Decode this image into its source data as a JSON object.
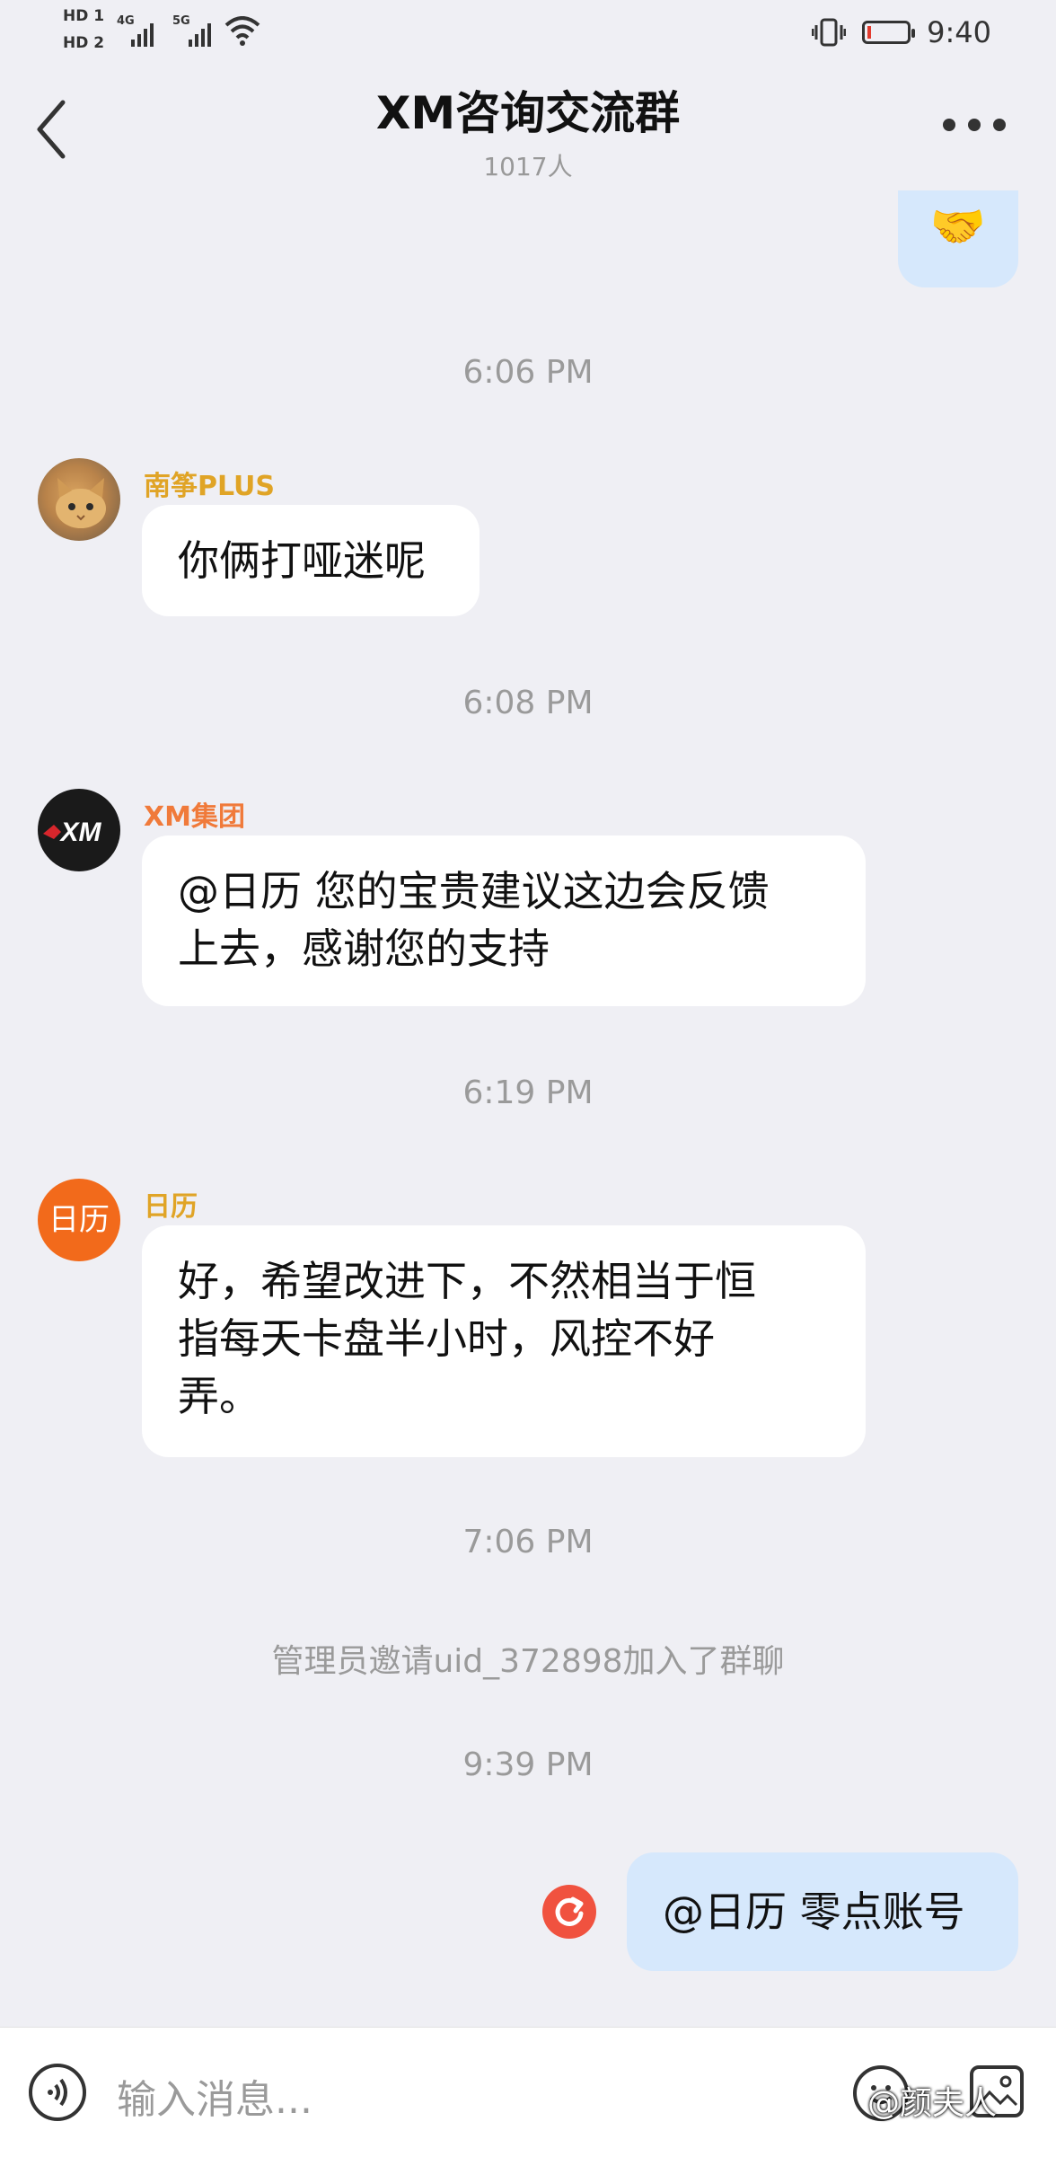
{
  "status_bar": {
    "hd1": "HD 1",
    "hd2": "HD 2",
    "net1": "4G",
    "net2": "5G",
    "time": "9:40"
  },
  "header": {
    "title": "XM咨询交流群",
    "member_count": "1017人"
  },
  "messages": [
    {
      "type": "outgoing-emoji",
      "emoji": "🤝"
    },
    {
      "type": "time",
      "text": "6:06 PM"
    },
    {
      "type": "incoming",
      "sender": "南筝PLUS",
      "sender_color": "#e0a426",
      "text": "你俩打哑迷呢"
    },
    {
      "type": "time",
      "text": "6:08 PM"
    },
    {
      "type": "incoming",
      "sender": "XM集团",
      "sender_color": "#f07a3a",
      "avatar_text": "XM",
      "text_lines": [
        "@日历 您的宝贵建议这边会反馈",
        "上去，感谢您的支持"
      ]
    },
    {
      "type": "time",
      "text": "6:19 PM"
    },
    {
      "type": "incoming",
      "sender": "日历",
      "sender_color": "#e0a426",
      "avatar_text": "日历",
      "text_lines": [
        "好，希望改进下，不然相当于恒",
        "指每天卡盘半小时，风控不好",
        "弄。"
      ]
    },
    {
      "type": "time",
      "text": "7:06 PM"
    },
    {
      "type": "system",
      "text": "管理员邀请uid_372898加入了群聊"
    },
    {
      "type": "time",
      "text": "9:39 PM"
    },
    {
      "type": "outgoing",
      "text": "@日历 零点账号",
      "status": "failed-resend"
    }
  ],
  "input_bar": {
    "placeholder": "输入消息...",
    "watermark": "@颜夫人"
  },
  "colors": {
    "background": "#efeff4",
    "outgoing_bubble": "#d6e8fc",
    "resend_red": "#f0523f",
    "calendar_avatar": "#f26a1b"
  }
}
